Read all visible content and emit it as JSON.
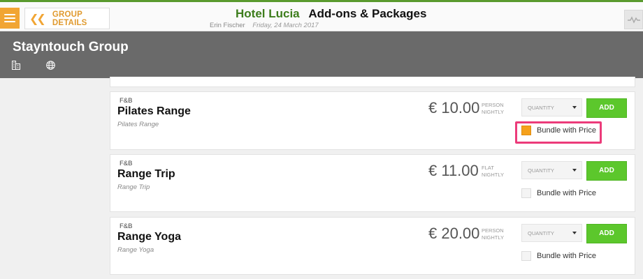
{
  "header": {
    "back_label": "GROUP DETAILS",
    "hotel_name": "Hotel Lucia",
    "page_title": "Add-ons & Packages",
    "user_name": "Erin Fischer",
    "date": "Friday, 24 March 2017"
  },
  "group": {
    "name": "Stayntouch Group"
  },
  "addons": [
    {
      "category": "F&B",
      "name": "Pilates Range",
      "description": "Pilates Range",
      "price": "€ 10.00",
      "unit_line1": "PERSON",
      "unit_line2": "NIGHTLY",
      "quantity_placeholder": "QUANTITY",
      "add_label": "ADD",
      "bundle_label": "Bundle with Price",
      "bundle_checked": true
    },
    {
      "category": "F&B",
      "name": "Range Trip",
      "description": "Range Trip",
      "price": "€ 11.00",
      "unit_line1": "FLAT",
      "unit_line2": "NIGHTLY",
      "quantity_placeholder": "QUANTITY",
      "add_label": "ADD",
      "bundle_label": "Bundle with Price",
      "bundle_checked": false
    },
    {
      "category": "F&B",
      "name": "Range Yoga",
      "description": "Range Yoga",
      "price": "€ 20.00",
      "unit_line1": "PERSON",
      "unit_line2": "NIGHTLY",
      "quantity_placeholder": "QUANTITY",
      "add_label": "ADD",
      "bundle_label": "Bundle with Price",
      "bundle_checked": false
    }
  ],
  "colors": {
    "accent_orange": "#f1a533",
    "brand_green": "#3d7d1c",
    "add_green": "#5cc72c",
    "highlight_pink": "#ec3b7a",
    "header_gray": "#6a6a6a"
  },
  "icons": {
    "menu": "hamburger-icon",
    "back": "double-chevron-left-icon",
    "right_control": "activity-line-icon",
    "building": "building-icon",
    "globe": "globe-icon",
    "dropdown": "caret-down-icon"
  }
}
